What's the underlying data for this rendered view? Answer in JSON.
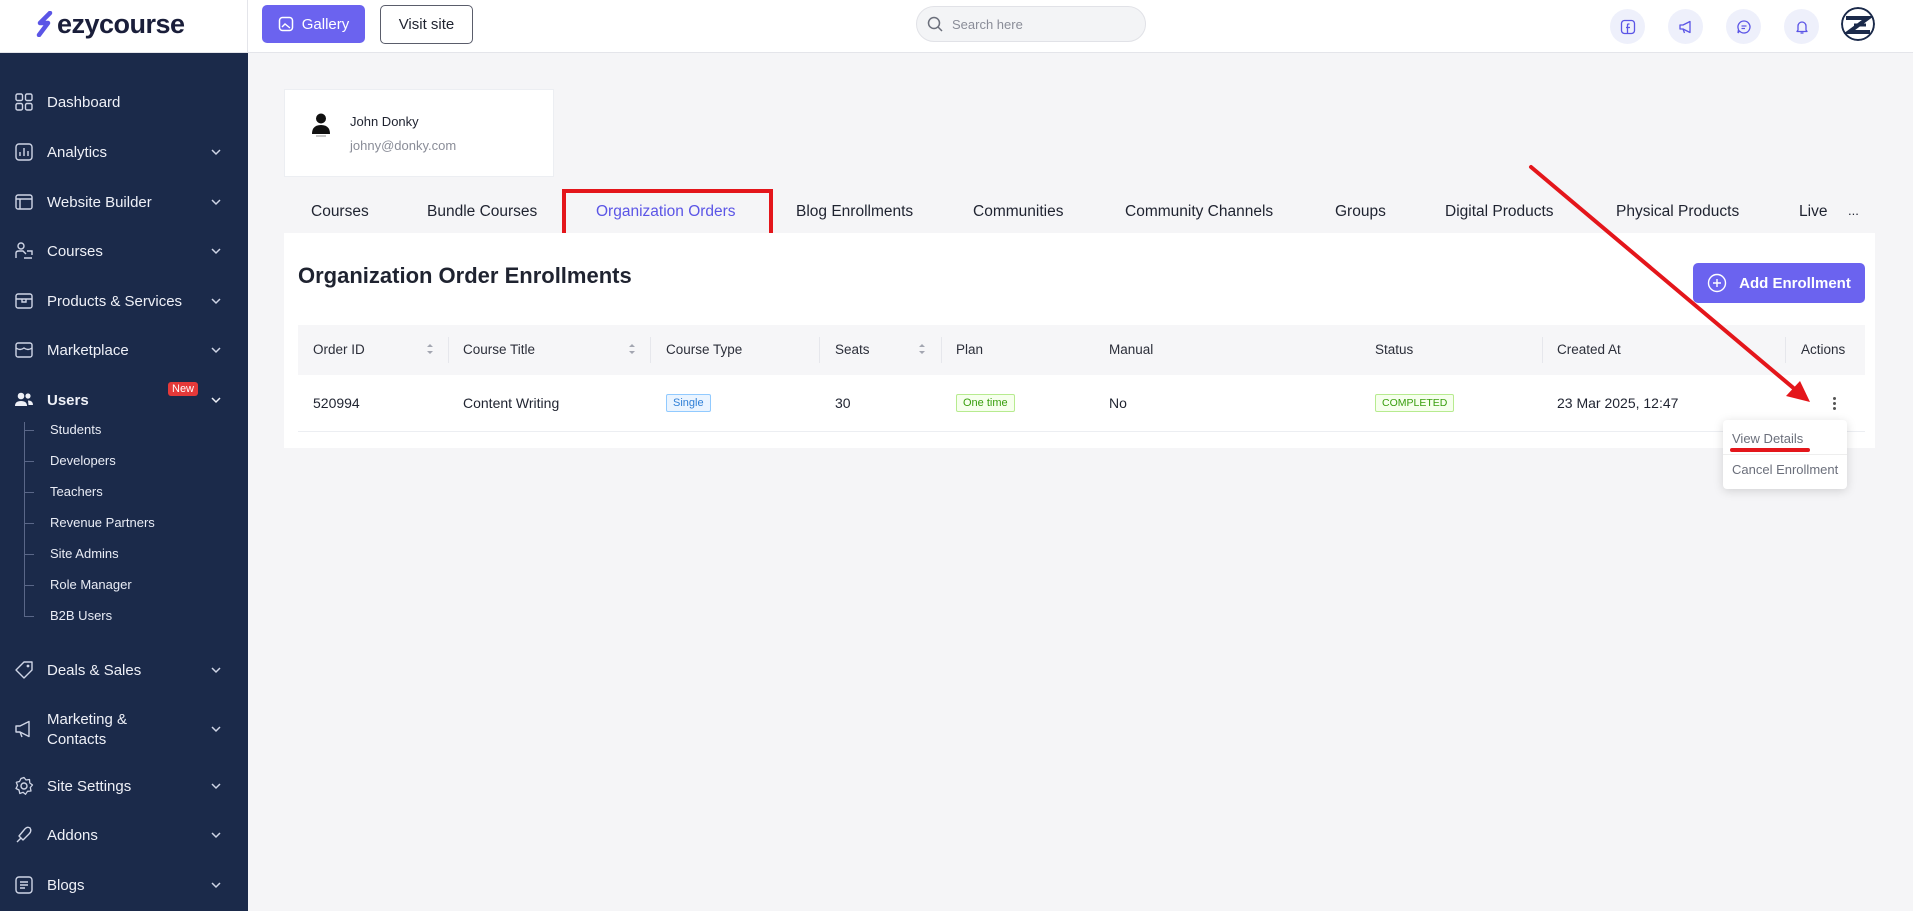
{
  "topbar": {
    "logo_text": "ezycourse",
    "gallery_label": "Gallery",
    "visit_site_label": "Visit site",
    "search_placeholder": "Search here",
    "icons": [
      "facebook-icon",
      "megaphone-icon",
      "chat-icon",
      "bell-icon"
    ]
  },
  "sidebar": {
    "items": [
      {
        "label": "Dashboard",
        "icon": "dashboard-icon"
      },
      {
        "label": "Analytics",
        "icon": "analytics-icon"
      },
      {
        "label": "Website Builder",
        "icon": "website-builder-icon"
      },
      {
        "label": "Courses",
        "icon": "courses-icon"
      },
      {
        "label": "Products & Services",
        "icon": "products-icon"
      },
      {
        "label": "Marketplace",
        "icon": "marketplace-icon"
      },
      {
        "label": "Users",
        "icon": "users-icon",
        "badge": "New"
      },
      {
        "label": "Deals & Sales",
        "icon": "deals-icon"
      },
      {
        "label": "Marketing &",
        "label2": "Contacts",
        "icon": "marketing-icon"
      },
      {
        "label": "Site Settings",
        "icon": "settings-icon"
      },
      {
        "label": "Addons",
        "icon": "addons-icon"
      },
      {
        "label": "Blogs",
        "icon": "blogs-icon"
      }
    ],
    "users_subitems": [
      "Students",
      "Developers",
      "Teachers",
      "Revenue Partners",
      "Site Admins",
      "Role Manager",
      "B2B Users"
    ]
  },
  "profile": {
    "name": "John Donky",
    "email": "johny@donky.com"
  },
  "tabs": [
    {
      "label": "Courses"
    },
    {
      "label": "Bundle Courses"
    },
    {
      "label": "Organization Orders",
      "active": true
    },
    {
      "label": "Blog Enrollments"
    },
    {
      "label": "Communities"
    },
    {
      "label": "Community Channels"
    },
    {
      "label": "Groups"
    },
    {
      "label": "Digital Products"
    },
    {
      "label": "Physical Products"
    },
    {
      "label": "Live F"
    }
  ],
  "tabs_more": "...",
  "panel": {
    "title": "Organization Order Enrollments",
    "add_label": "Add Enrollment"
  },
  "table": {
    "headers": [
      "Order ID",
      "Course Title",
      "Course Type",
      "Seats",
      "Plan",
      "Manual",
      "Status",
      "Created At",
      "Actions"
    ],
    "rows": [
      {
        "order_id": "520994",
        "course_title": "Content Writing",
        "course_type": "Single",
        "seats": "30",
        "plan": "One time",
        "manual": "No",
        "status": "COMPLETED",
        "created_at": "23 Mar 2025, 12:47"
      }
    ]
  },
  "dropdown": {
    "view_details": "View Details",
    "cancel_enrollment": "Cancel Enrollment"
  },
  "colors": {
    "accent": "#6b63ef",
    "sidebar_bg": "#1b2a4a",
    "annotation_red": "#e4161b"
  }
}
